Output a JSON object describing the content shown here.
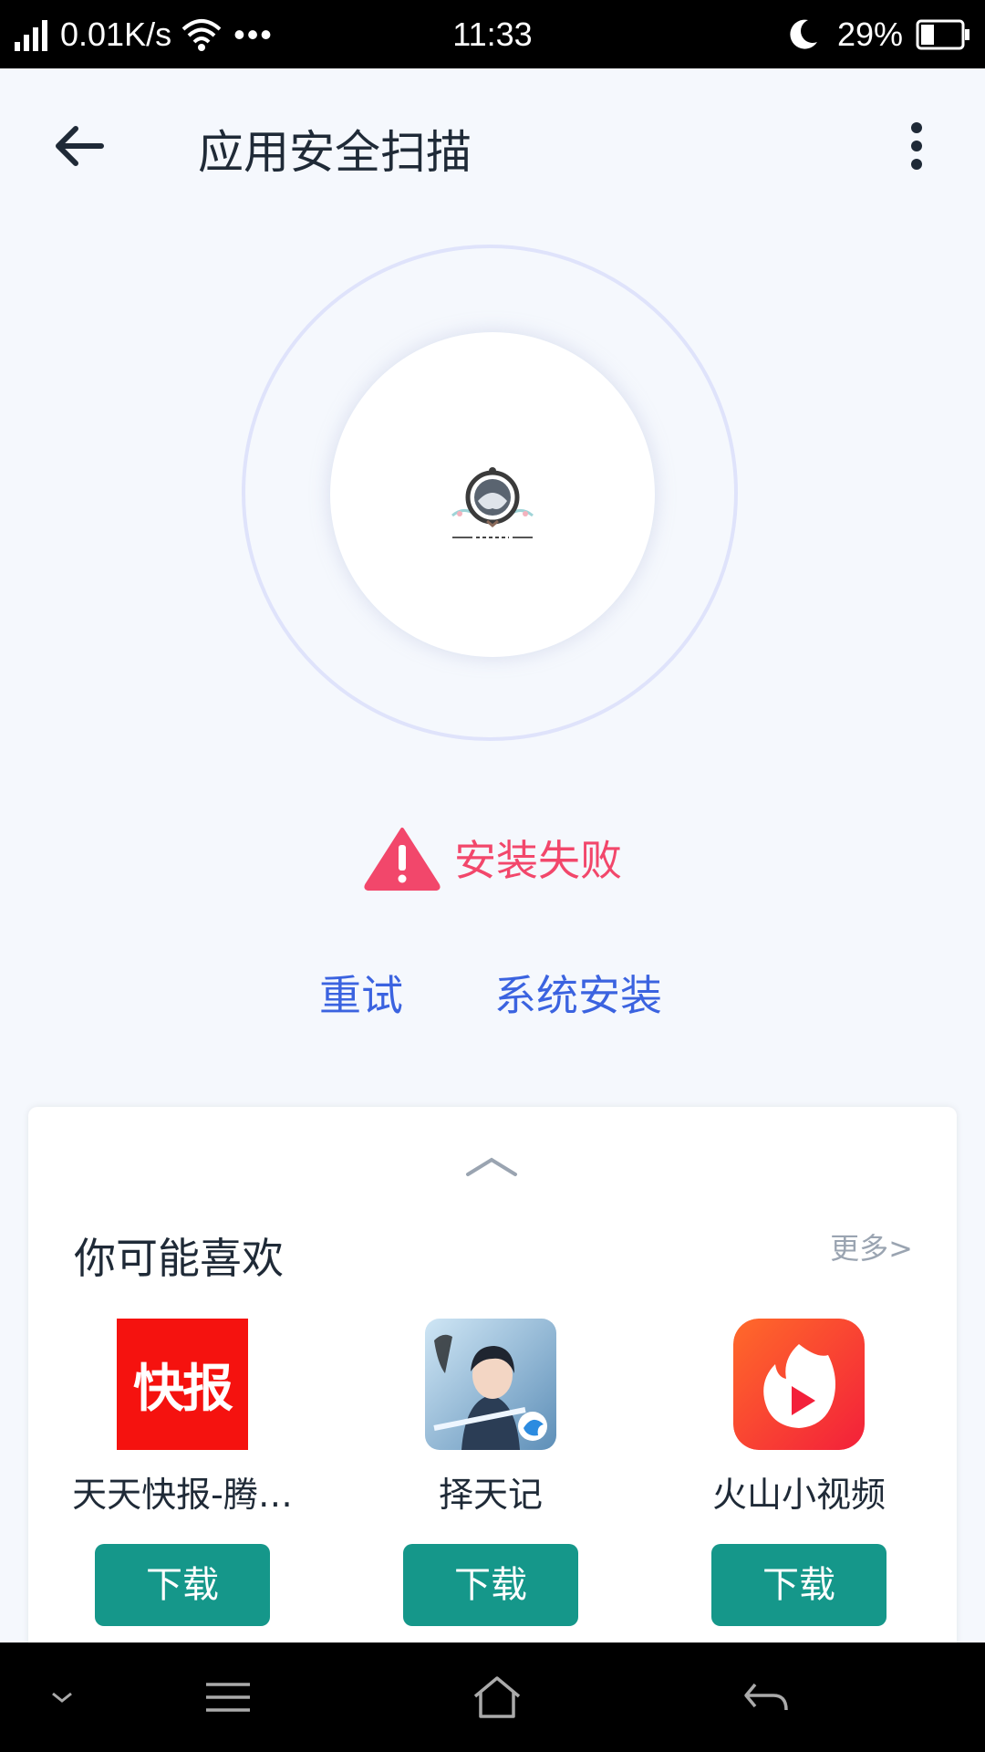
{
  "status_bar": {
    "speed": "0.01K/s",
    "dots": "•••",
    "time": "11:33",
    "battery": "29%"
  },
  "header": {
    "title": "应用安全扫描"
  },
  "scan": {
    "status": "安装失败"
  },
  "actions": {
    "retry": "重试",
    "system_install": "系统安装"
  },
  "recommend": {
    "title": "你可能喜欢",
    "more": "更多>",
    "apps": [
      {
        "name": "天天快报-腾…",
        "button": "下载",
        "logo_text": "快报"
      },
      {
        "name": "择天记",
        "button": "下载"
      },
      {
        "name": "火山小视频",
        "button": "下载"
      }
    ]
  },
  "colors": {
    "error": "#f2476b",
    "link": "#3b63e0",
    "download": "#15978a"
  }
}
